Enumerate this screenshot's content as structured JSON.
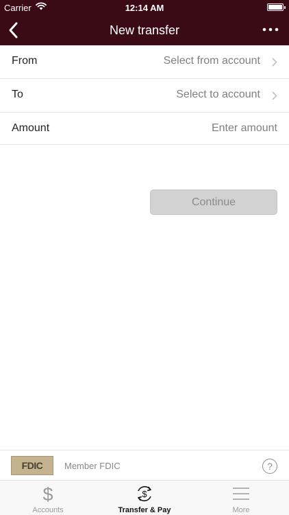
{
  "status_bar": {
    "carrier": "Carrier",
    "time": "12:14 AM"
  },
  "nav": {
    "title": "New transfer"
  },
  "form": {
    "from": {
      "label": "From",
      "placeholder": "Select from account"
    },
    "to": {
      "label": "To",
      "placeholder": "Select to account"
    },
    "amount": {
      "label": "Amount",
      "placeholder": "Enter amount"
    }
  },
  "continue_label": "Continue",
  "footer": {
    "fdic_logo_text": "FDIC",
    "member_text": "Member FDIC",
    "help_glyph": "?"
  },
  "tabs": [
    {
      "label": "Accounts",
      "icon": "dollar-icon",
      "active": false
    },
    {
      "label": "Transfer & Pay",
      "icon": "transfer-pay-icon",
      "active": true
    },
    {
      "label": "More",
      "icon": "menu-icon",
      "active": false
    }
  ],
  "colors": {
    "header_bg": "#3b0b15",
    "button_disabled": "#d2d2d2",
    "tabbar_bg": "#f8f8f8"
  }
}
